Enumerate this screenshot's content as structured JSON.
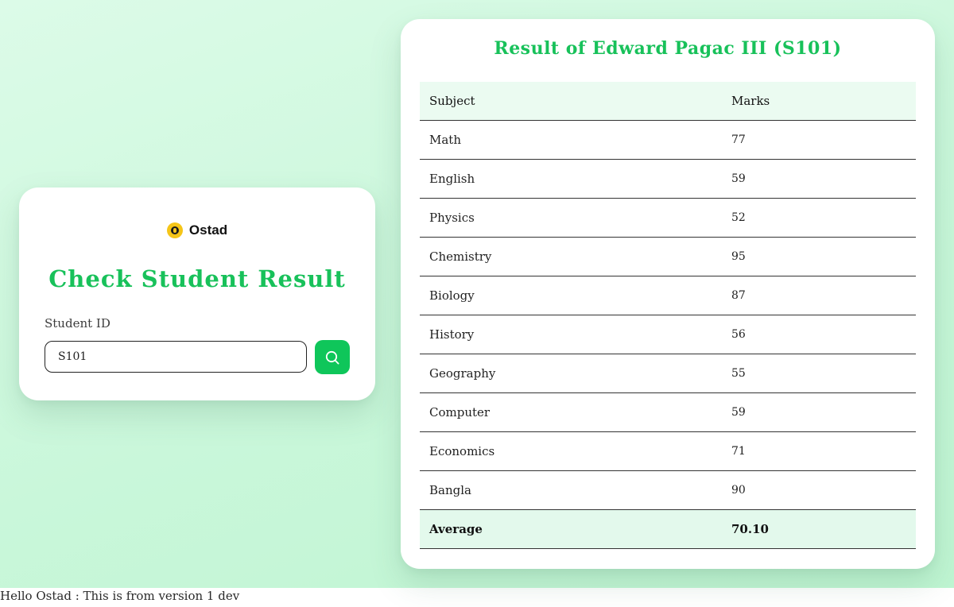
{
  "lookup": {
    "logo_text": "Ostad",
    "title": "Check Student Result",
    "field_label": "Student ID",
    "student_id_value": "S101",
    "search_icon": "search-icon"
  },
  "result": {
    "title": "Result of Edward Pagac III (S101)",
    "headers": {
      "subject": "Subject",
      "marks": "Marks"
    },
    "rows": [
      {
        "subject": "Math",
        "marks": "77"
      },
      {
        "subject": "English",
        "marks": "59"
      },
      {
        "subject": "Physics",
        "marks": "52"
      },
      {
        "subject": "Chemistry",
        "marks": "95"
      },
      {
        "subject": "Biology",
        "marks": "87"
      },
      {
        "subject": "History",
        "marks": "56"
      },
      {
        "subject": "Geography",
        "marks": "55"
      },
      {
        "subject": "Computer",
        "marks": "59"
      },
      {
        "subject": "Economics",
        "marks": "71"
      },
      {
        "subject": "Bangla",
        "marks": "90"
      }
    ],
    "average": {
      "label": "Average",
      "value": "70.10"
    }
  },
  "footer": {
    "text": "Hello Ostad : This is from version 1 dev"
  },
  "colors": {
    "accent": "#18c15a",
    "button": "#0fc65a",
    "header_bg": "#ebfbf1",
    "average_bg": "#e3f9ec"
  }
}
